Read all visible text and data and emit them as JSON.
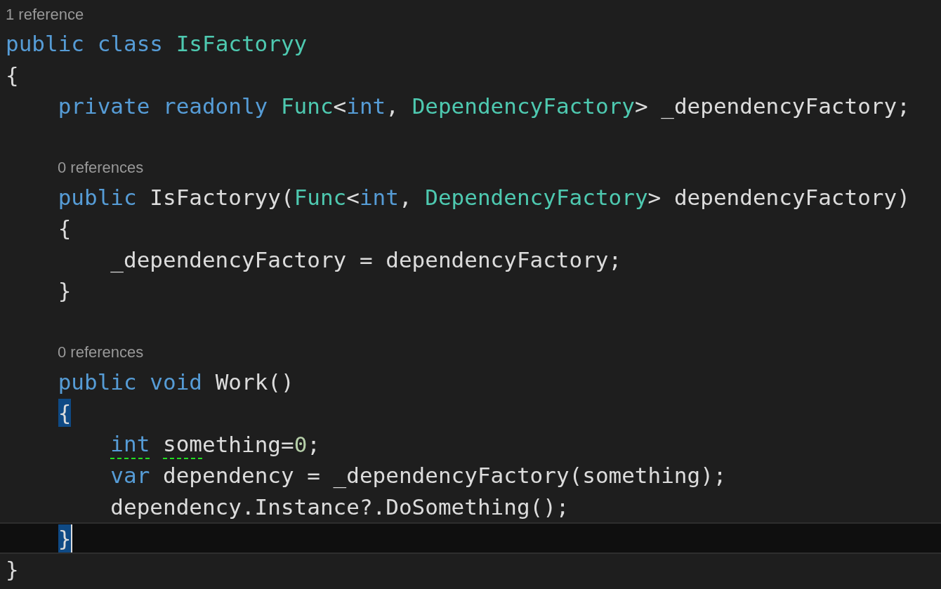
{
  "lines": [
    {
      "kind": "codelens",
      "text": "1 reference"
    },
    {
      "kind": "code",
      "tokens": [
        {
          "text": "public class ",
          "kind": "keyword"
        },
        {
          "text": "IsFactoryy",
          "kind": "type"
        }
      ]
    },
    {
      "kind": "code",
      "tokens": [
        {
          "text": "{",
          "kind": "plain"
        }
      ]
    },
    {
      "kind": "code",
      "tokens": [
        {
          "text": "    private readonly ",
          "kind": "keyword"
        },
        {
          "text": "Func",
          "kind": "type"
        },
        {
          "text": "<",
          "kind": "plain"
        },
        {
          "text": "int",
          "kind": "keyword"
        },
        {
          "text": ", ",
          "kind": "plain"
        },
        {
          "text": "DependencyFactory",
          "kind": "type"
        },
        {
          "text": "> _dependencyFactory;",
          "kind": "plain"
        }
      ]
    },
    {
      "kind": "blank"
    },
    {
      "kind": "member_codelens",
      "text": "0 references"
    },
    {
      "kind": "code",
      "tokens": [
        {
          "text": "    public ",
          "kind": "keyword"
        },
        {
          "text": "IsFactoryy(",
          "kind": "plain"
        },
        {
          "text": "Func",
          "kind": "type"
        },
        {
          "text": "<",
          "kind": "plain"
        },
        {
          "text": "int",
          "kind": "keyword"
        },
        {
          "text": ", ",
          "kind": "plain"
        },
        {
          "text": "DependencyFactory",
          "kind": "type"
        },
        {
          "text": "> dependencyFactory)",
          "kind": "plain"
        }
      ]
    },
    {
      "kind": "code",
      "tokens": [
        {
          "text": "    {",
          "kind": "plain"
        }
      ]
    },
    {
      "kind": "code",
      "tokens": [
        {
          "text": "        _dependencyFactory = dependencyFactory;",
          "kind": "plain"
        }
      ]
    },
    {
      "kind": "code",
      "tokens": [
        {
          "text": "    }",
          "kind": "plain"
        }
      ]
    },
    {
      "kind": "blank"
    },
    {
      "kind": "member_codelens",
      "text": "0 references"
    },
    {
      "kind": "code",
      "tokens": [
        {
          "text": "    public void ",
          "kind": "keyword"
        },
        {
          "text": "Work()",
          "kind": "plain"
        }
      ]
    },
    {
      "kind": "code",
      "tokens": [
        {
          "text": "    {",
          "kind": "plain",
          "highlighted": true
        }
      ]
    },
    {
      "kind": "code",
      "tokens": [
        {
          "text": "        int",
          "kind": "keyword",
          "warning": true
        },
        {
          "text": " som",
          "kind": "plain",
          "warning": true
        },
        {
          "text": "ething=",
          "kind": "plain"
        },
        {
          "text": "0",
          "kind": "number"
        },
        {
          "text": ";",
          "kind": "plain"
        }
      ]
    },
    {
      "kind": "code",
      "tokens": [
        {
          "text": "        var ",
          "kind": "keyword"
        },
        {
          "text": "dependency = _dependencyFactory(something);",
          "kind": "plain"
        }
      ]
    },
    {
      "kind": "code",
      "tokens": [
        {
          "text": "        dependency.Instance?.DoSomething();",
          "kind": "plain"
        }
      ]
    },
    {
      "kind": "code",
      "current": true,
      "tokens": [
        {
          "text": "    }",
          "kind": "plain",
          "highlighted": true
        }
      ]
    },
    {
      "kind": "code",
      "tokens": [
        {
          "text": "}",
          "kind": "plain"
        }
      ]
    }
  ]
}
